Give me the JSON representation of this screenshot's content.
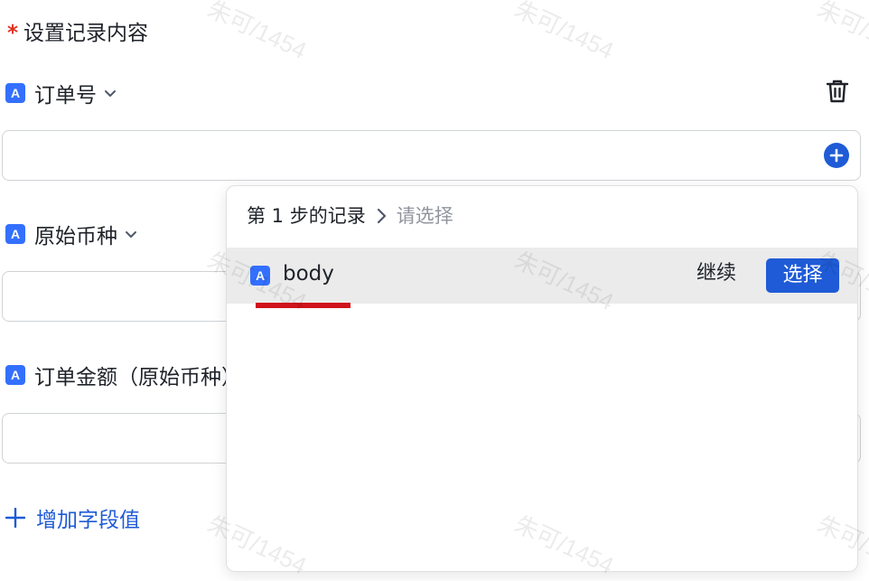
{
  "section": {
    "required_mark": "*",
    "title": "设置记录内容"
  },
  "fields": [
    {
      "type_icon": "text-type-icon",
      "badge": "A",
      "label": "订单号"
    },
    {
      "type_icon": "text-type-icon",
      "badge": "A",
      "label": "原始币种"
    },
    {
      "type_icon": "text-type-icon",
      "badge": "A",
      "label": "订单金额（原始币种）"
    }
  ],
  "add_field": {
    "label": "增加字段值"
  },
  "popup": {
    "breadcrumb": {
      "step": "第 1 步的记录",
      "current": "请选择"
    },
    "options": [
      {
        "badge": "A",
        "name": "body",
        "continue_label": "继续",
        "select_label": "选择"
      }
    ]
  },
  "watermark": "朱可/1454",
  "colors": {
    "accent": "#1f5bd6",
    "type_icon": "#3370ff",
    "required": "#e0301e",
    "highlight_underline": "#d0121b",
    "muted_text": "#8f959e"
  }
}
